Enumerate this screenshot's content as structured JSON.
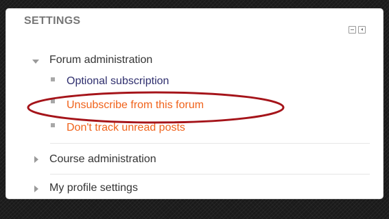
{
  "block": {
    "title": "SETTINGS",
    "controls": {
      "hide_icon": "minus-square-icon",
      "dock_icon": "dock-left-icon"
    }
  },
  "forum_admin": {
    "label": "Forum administration",
    "state": "expanded",
    "items": [
      {
        "label": "Optional subscription"
      },
      {
        "label": "Unsubscribe from this forum"
      },
      {
        "label": "Don't track unread posts"
      }
    ]
  },
  "course_admin": {
    "label": "Course administration",
    "state": "collapsed"
  },
  "profile_settings": {
    "label": "My profile settings",
    "state": "collapsed"
  },
  "colors": {
    "link_dark": "#2f2f6e",
    "link_orange": "#f0621a",
    "annotation": "#a5141a",
    "title": "#777777"
  }
}
